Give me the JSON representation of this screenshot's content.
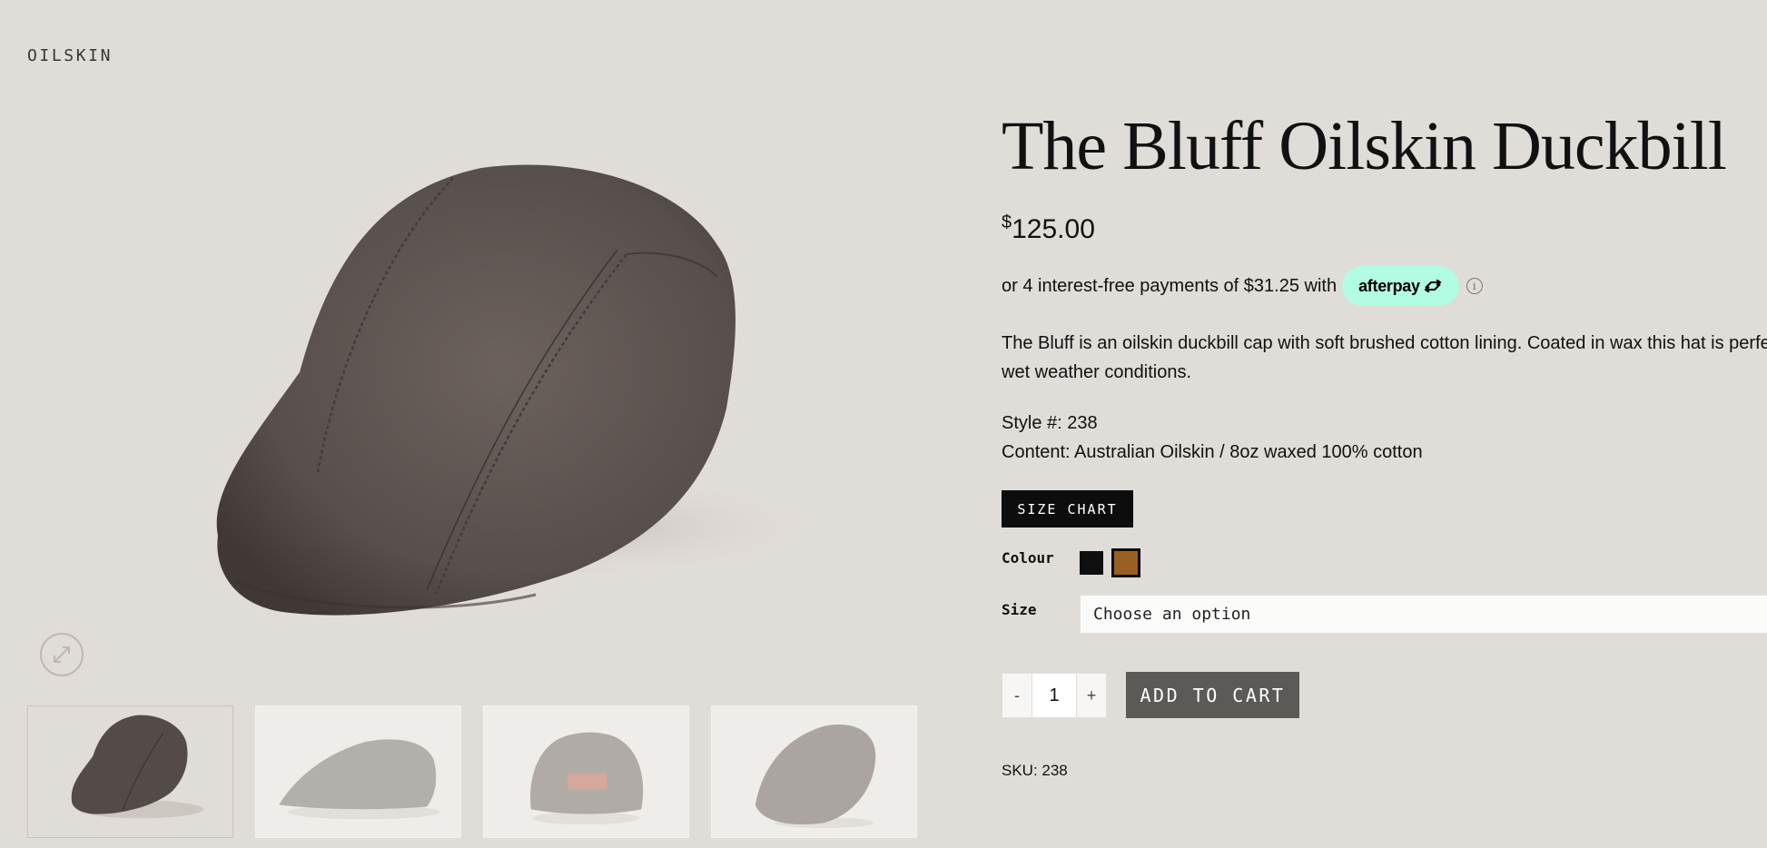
{
  "header": {
    "brand": "OILSKIN"
  },
  "product": {
    "title": "The Bluff Oilskin Duckbill",
    "price_currency": "$",
    "price_amount": "125.00",
    "afterpay_text": "or 4 interest-free payments of $31.25 with",
    "afterpay_brand": "afterpay",
    "info_glyph": "i",
    "description": "The Bluff is an oilskin duckbill cap with soft brushed cotton lining. Coated in wax this hat is perfect for wet weather conditions.",
    "style": "Style #: 238",
    "content": "Content: Australian Oilskin / 8oz waxed 100% cotton",
    "sku": "SKU: 238"
  },
  "buttons": {
    "size_chart": "SIZE CHART",
    "add_to_cart": "ADD TO CART",
    "qty_minus": "-",
    "qty_plus": "+"
  },
  "options": {
    "colour_label": "Colour",
    "colours": [
      {
        "name": "black",
        "hex": "#0f0f0f",
        "selected": false
      },
      {
        "name": "brown",
        "hex": "#9a5f22",
        "selected": true
      }
    ],
    "size_label": "Size",
    "size_placeholder": "Choose an option",
    "quantity": "1"
  },
  "gallery": {
    "zoom_icon": "expand-arrows-icon",
    "thumbnails": [
      {
        "view": "three-quarter",
        "active": true
      },
      {
        "view": "side",
        "active": false
      },
      {
        "view": "back",
        "active": false
      },
      {
        "view": "front",
        "active": false
      }
    ]
  },
  "colors": {
    "background": "#e0dcd8",
    "afterpay_mint": "#b2fce4",
    "cap_main": "#5a524e",
    "button_dark": "#0d0d0d",
    "add_to_cart": "#5b5a57"
  }
}
